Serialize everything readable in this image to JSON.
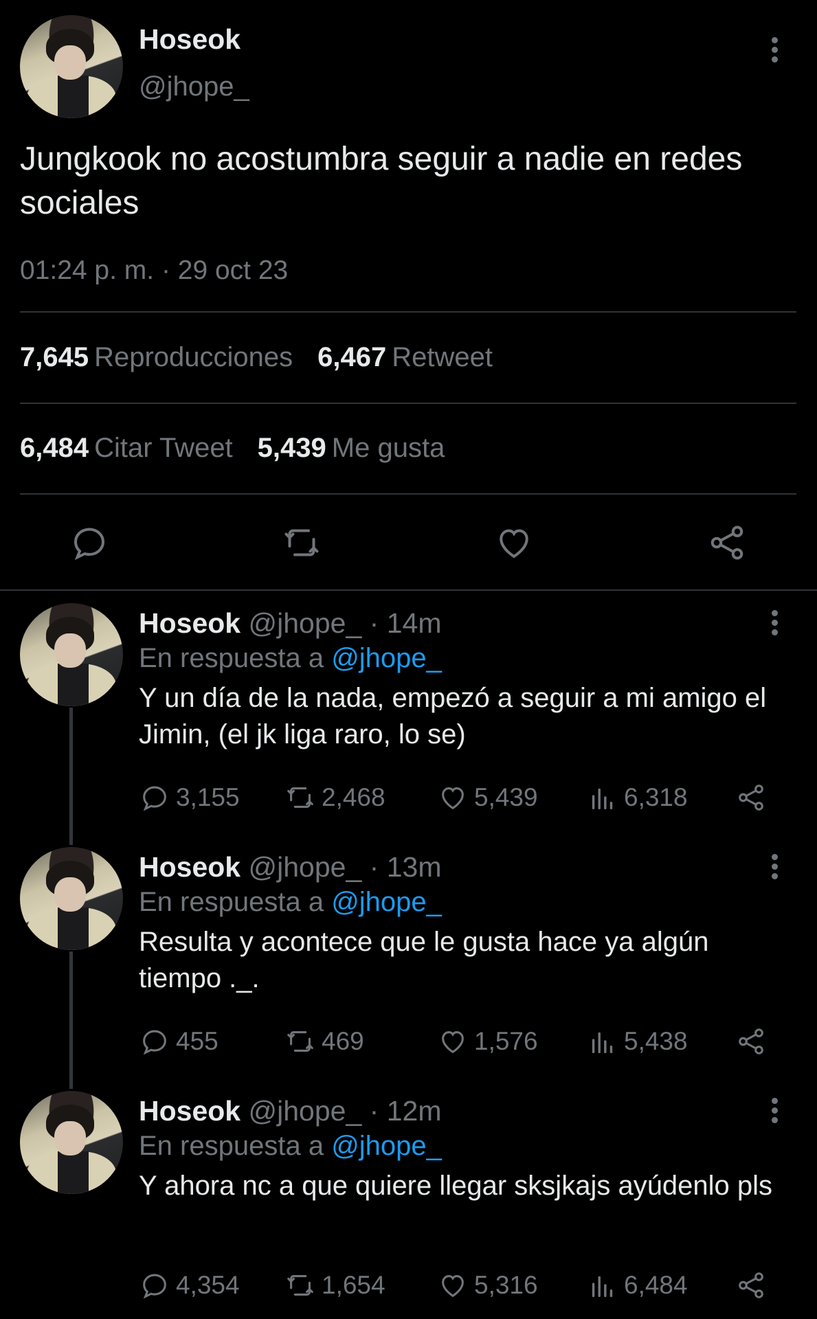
{
  "main_tweet": {
    "author_name": "Hoseok",
    "author_handle": "@jhope_",
    "text": "Jungkook no acostumbra seguir a nadie en redes sociales",
    "timestamp": "01:24 p. m. · 29 oct 23",
    "stats": {
      "views_count": "7,645",
      "views_label": "Reproducciones",
      "retweets_count": "6,467",
      "retweets_label": "Retweet",
      "quotes_count": "6,484",
      "quotes_label": "Citar Tweet",
      "likes_count": "5,439",
      "likes_label": "Me gusta"
    }
  },
  "replies": [
    {
      "author_name": "Hoseok",
      "author_handle": "@jhope_",
      "time": "· 14m",
      "in_reply_label": "En respuesta a",
      "in_reply_handle": "@jhope_",
      "text": "Y un día de la nada, empezó a seguir a mi amigo el Jimin, (el jk liga raro, lo se)",
      "replies": "3,155",
      "retweets": "2,468",
      "likes": "5,439",
      "views": "6,318"
    },
    {
      "author_name": "Hoseok",
      "author_handle": "@jhope_",
      "time": "· 13m",
      "in_reply_label": "En respuesta a",
      "in_reply_handle": "@jhope_",
      "text": "Resulta y acontece que le gusta hace ya algún tiempo ._.",
      "replies": "455",
      "retweets": "469",
      "likes": "1,576",
      "views": "5,438"
    },
    {
      "author_name": "Hoseok",
      "author_handle": "@jhope_",
      "time": "· 12m",
      "in_reply_label": "En respuesta a",
      "in_reply_handle": "@jhope_",
      "text": "Y ahora nc a que quiere llegar sksjkajs ayúdenlo pls",
      "replies": "4,354",
      "retweets": "1,654",
      "likes": "5,316",
      "views": "6,484"
    }
  ],
  "icons": [
    "more-icon",
    "reply-icon",
    "retweet-icon",
    "like-icon",
    "share-icon",
    "views-icon"
  ],
  "colors": {
    "background": "#000000",
    "text": "#e7e9ea",
    "muted": "#71767b",
    "link": "#1d9bf0",
    "divider": "#2f3336"
  }
}
